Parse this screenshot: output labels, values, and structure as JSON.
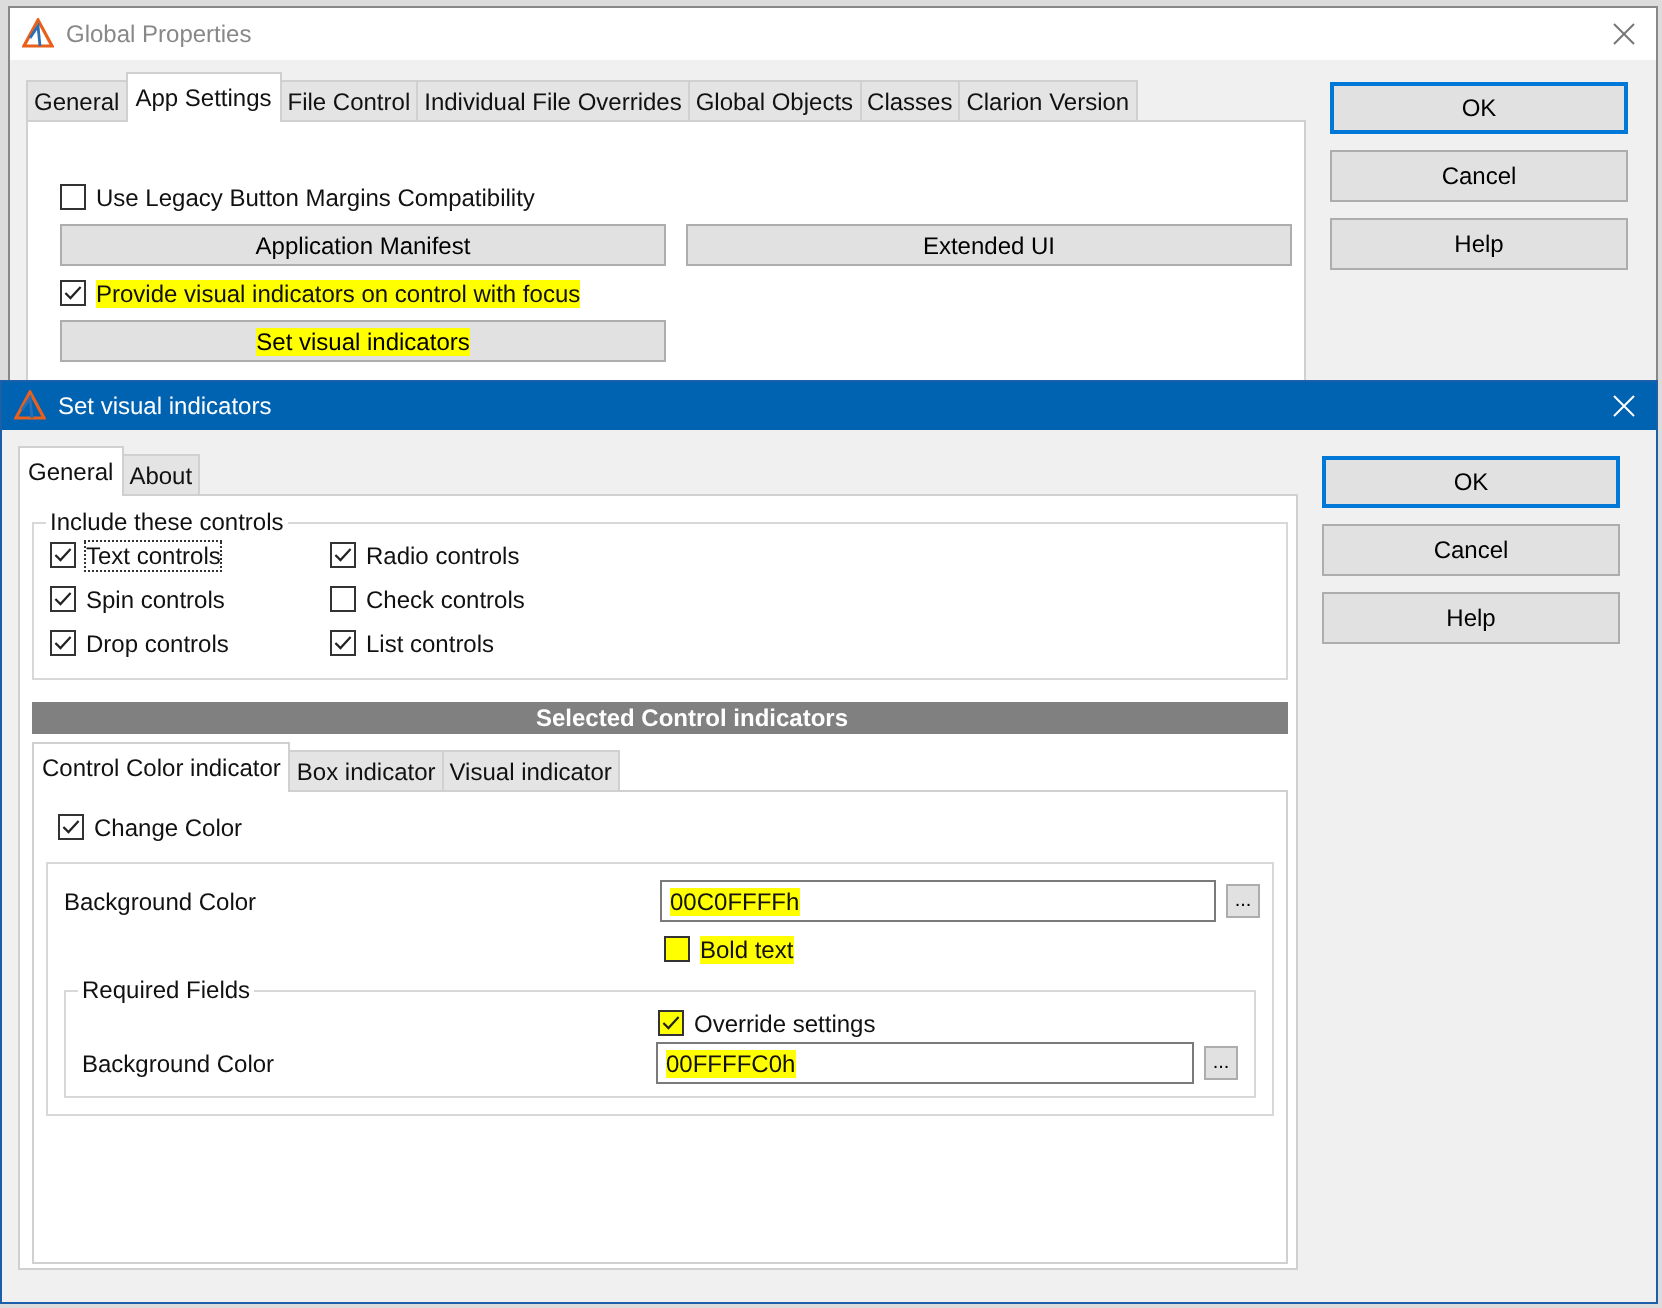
{
  "back_window": {
    "title": "Global Properties",
    "tabs": [
      {
        "label": "General",
        "selected": false
      },
      {
        "label": "App Settings",
        "selected": true
      },
      {
        "label": "File Control",
        "selected": false
      },
      {
        "label": "Individual File Overrides",
        "selected": false
      },
      {
        "label": "Global Objects",
        "selected": false
      },
      {
        "label": "Classes",
        "selected": false
      },
      {
        "label": "Clarion Version",
        "selected": false
      }
    ],
    "options": [
      {
        "kind": "checkbox",
        "label": "Use Legacy Button Margins Compatibility",
        "checked": false,
        "highlighted": false
      },
      {
        "kind": "buttons",
        "buttons": [
          {
            "label": "Application Manifest",
            "highlighted": false
          },
          {
            "label": "Extended UI",
            "highlighted": false
          }
        ]
      },
      {
        "kind": "checkbox",
        "label": "Provide visual indicators on control with focus",
        "checked": true,
        "highlighted": true
      },
      {
        "kind": "buttons",
        "buttons": [
          {
            "label": "Set visual indicators",
            "highlighted": true
          }
        ]
      }
    ],
    "buttons": [
      {
        "label": "OK",
        "default": true
      },
      {
        "label": "Cancel",
        "default": false
      },
      {
        "label": "Help",
        "default": false
      }
    ]
  },
  "dialog": {
    "title": "Set visual indicators",
    "tabs": [
      {
        "label": "General",
        "selected": true
      },
      {
        "label": "About",
        "selected": false
      }
    ],
    "include_group": {
      "title": "Include these controls",
      "controls": [
        {
          "label": "Text controls",
          "checked": true,
          "focused": true
        },
        {
          "label": "Radio controls",
          "checked": true,
          "focused": false
        },
        {
          "label": "Spin controls",
          "checked": true,
          "focused": false
        },
        {
          "label": "Check controls",
          "checked": false,
          "focused": false
        },
        {
          "label": "Drop controls",
          "checked": true,
          "focused": false
        },
        {
          "label": "List controls",
          "checked": true,
          "focused": false
        }
      ]
    },
    "section_header": "Selected Control indicators",
    "indicator_tabs": [
      {
        "label": "Control Color indicator",
        "selected": true
      },
      {
        "label": "Box indicator",
        "selected": false
      },
      {
        "label": "Visual indicator",
        "selected": false
      }
    ],
    "change_color": {
      "label": "Change Color",
      "checked": true
    },
    "background_color": {
      "label": "Background Color",
      "value": "00C0FFFFh",
      "highlighted": true,
      "browse": "..."
    },
    "bold_text": {
      "label": "Bold text",
      "checked": false,
      "highlighted": true
    },
    "required_fields": {
      "title": "Required Fields",
      "override": {
        "label": "Override settings",
        "checked": true,
        "highlighted": true
      },
      "background_color": {
        "label": "Background Color",
        "value": "00FFFFC0h",
        "highlighted": true,
        "browse": "..."
      }
    },
    "buttons": [
      {
        "label": "OK",
        "default": true
      },
      {
        "label": "Cancel",
        "default": false
      },
      {
        "label": "Help",
        "default": false
      }
    ]
  }
}
